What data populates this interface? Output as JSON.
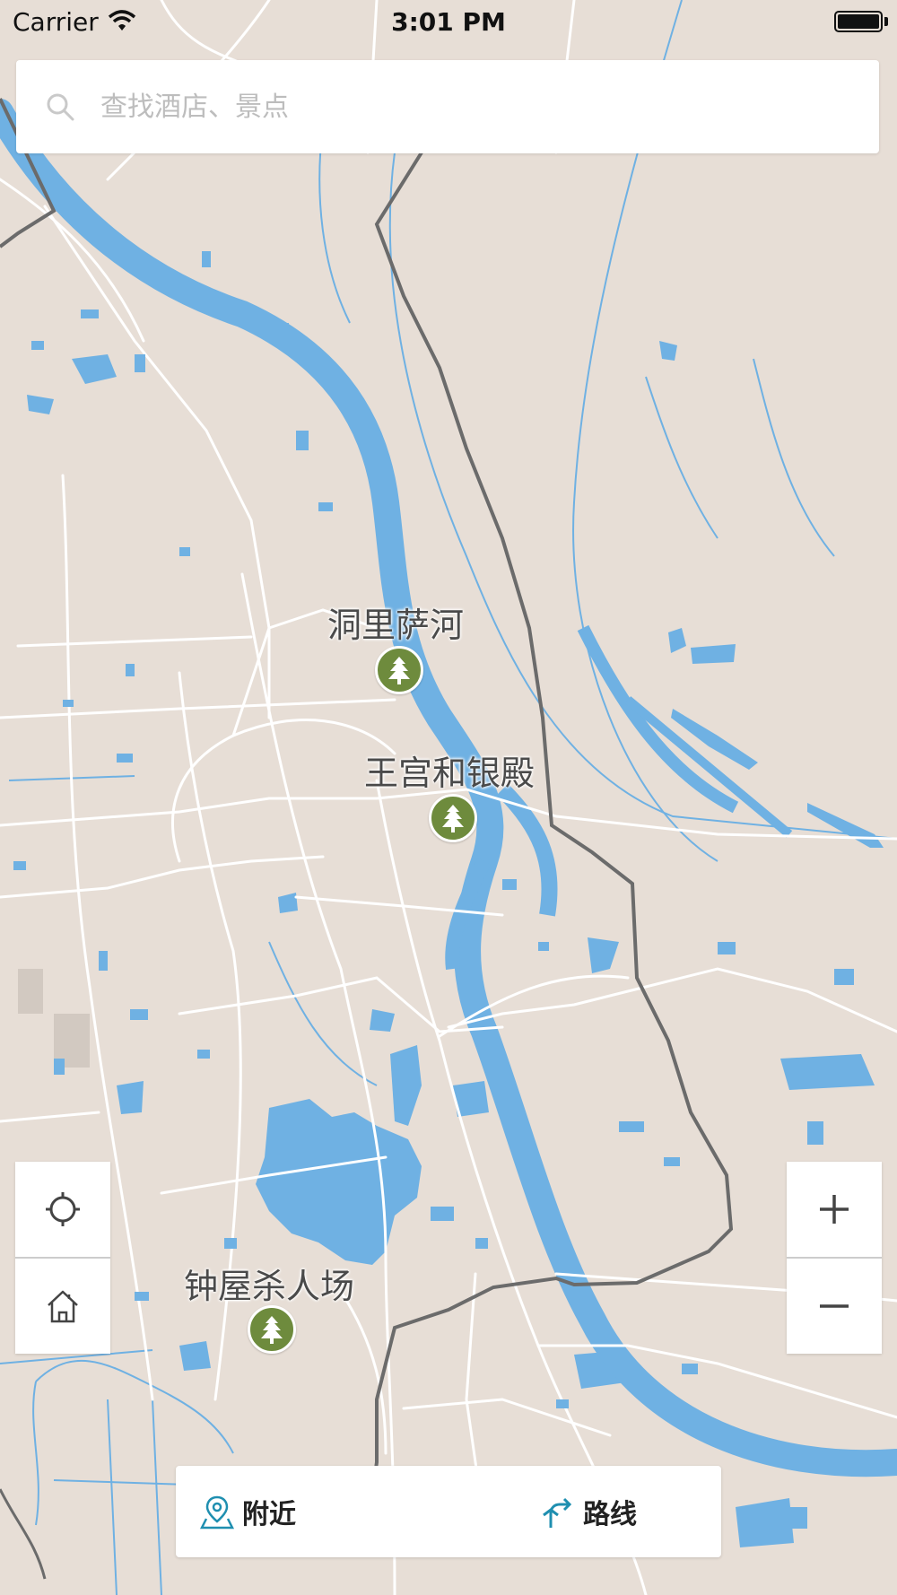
{
  "status_bar": {
    "carrier": "Carrier",
    "time": "3:01 PM"
  },
  "search": {
    "placeholder": "查找酒店、景点"
  },
  "map": {
    "places": [
      {
        "name": "洞里萨河",
        "icon": "park-tree-icon"
      },
      {
        "name": "王宫和银殿",
        "icon": "park-tree-icon"
      },
      {
        "name": "钟屋杀人场",
        "icon": "park-tree-icon"
      }
    ],
    "colors": {
      "land": "#e7ded6",
      "water": "#6fb1e3",
      "road": "#ffffff",
      "border": "#6b6b6b",
      "poi": "#6e8b3d"
    }
  },
  "controls": {
    "locate_icon": "crosshair-icon",
    "home_icon": "home-icon",
    "zoom_in_icon": "plus-icon",
    "zoom_out_icon": "minus-icon"
  },
  "bottom_bar": {
    "nearby_label": "附近",
    "route_label": "路线",
    "accent": "#1f8fb0"
  }
}
